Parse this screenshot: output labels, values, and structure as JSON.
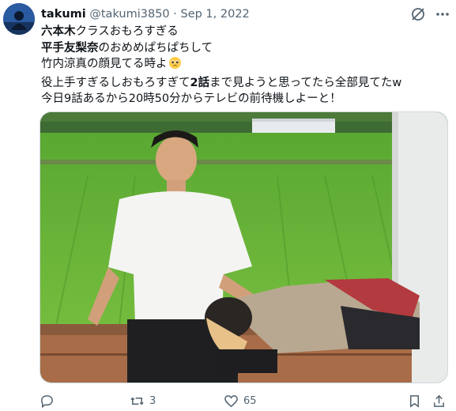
{
  "tweet": {
    "display_name": "takumi",
    "handle": "@takumi3850",
    "separator": "·",
    "date": "Sep 1, 2022",
    "lines": [
      {
        "bold": "六本木",
        "rest": "クラスおもろすぎる"
      },
      {
        "bold": "平手友梨奈",
        "rest": "のおめめぱちぱちして"
      },
      {
        "text": "竹内涼真の顔見てる時よ"
      },
      {
        "pre": "役上手すぎるしおもろすぎて",
        "bold": "2話",
        "post": "まで見ようと思ってたら全部見てたw"
      },
      {
        "text": "今日9話あるから20時50分からテレビの前待機しよーと！"
      }
    ],
    "emoji": "pleading-face-emoji"
  },
  "actions": {
    "reply_count": "",
    "retweet_count": "3",
    "like_count": "65"
  },
  "icons": [
    "grok-icon",
    "more-icon",
    "reply-icon",
    "retweet-icon",
    "like-icon",
    "bookmark-icon",
    "share-icon"
  ],
  "colors": {
    "text": "#0f1419",
    "muted": "#536471",
    "grass": "#6fb83a",
    "shirt": "#f4f4f2"
  }
}
